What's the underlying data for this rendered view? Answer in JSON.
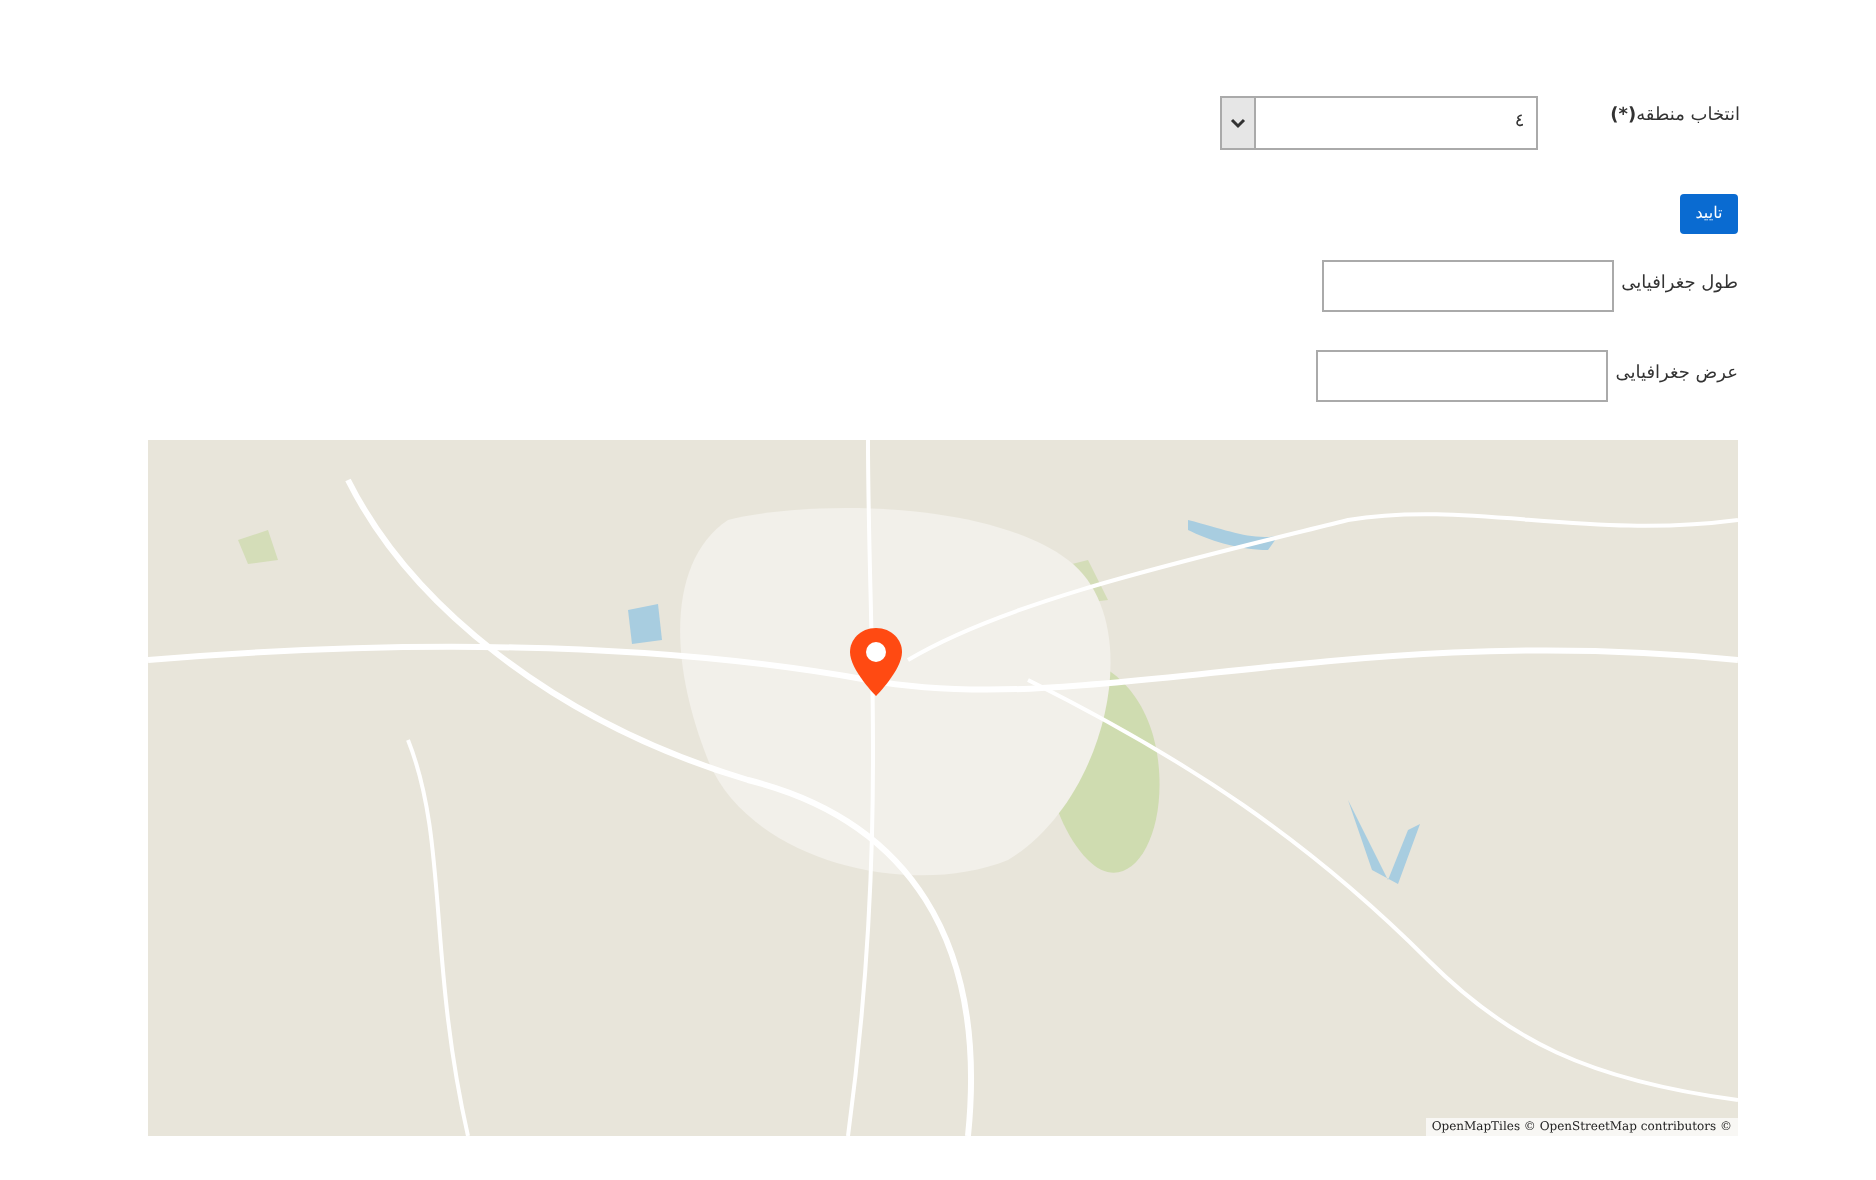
{
  "region_select": {
    "label": "انتخاب منطقه**(*)**",
    "value": "٤"
  },
  "confirm_button": {
    "label": "تایید"
  },
  "longitude": {
    "label": "طول جغرافیایی"
  },
  "latitude": {
    "label": "عرض جغرافیایی"
  },
  "map": {
    "kind": "picture",
    "attribution": "OpenMapTiles © OpenStreetMap contributors ©"
  }
}
